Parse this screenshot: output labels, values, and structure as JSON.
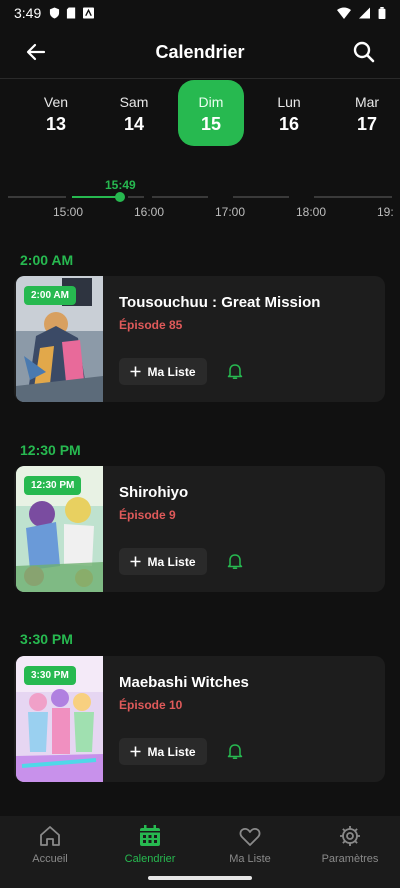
{
  "status_bar": {
    "time": "3:49"
  },
  "header": {
    "title": "Calendrier"
  },
  "days": [
    {
      "name": "Ven",
      "num": "13"
    },
    {
      "name": "Sam",
      "num": "14"
    },
    {
      "name": "Dim",
      "num": "15",
      "active": true
    },
    {
      "name": "Lun",
      "num": "16"
    },
    {
      "name": "Mar",
      "num": "17"
    }
  ],
  "timeline": {
    "now": "15:49",
    "labels": [
      "15:00",
      "16:00",
      "17:00",
      "18:00",
      "19:"
    ]
  },
  "sections": [
    {
      "time": "2:00 AM",
      "badge": "2:00 AM",
      "title": "Tousouchuu : Great Mission",
      "episode": "Épisode 85",
      "button": "Ma Liste"
    },
    {
      "time": "12:30 PM",
      "badge": "12:30 PM",
      "title": "Shirohiyo",
      "episode": "Épisode 9",
      "button": "Ma Liste"
    },
    {
      "time": "3:30 PM",
      "badge": "3:30 PM",
      "title": "Maebashi Witches",
      "episode": "Épisode 10",
      "button": "Ma Liste"
    }
  ],
  "nav": {
    "items": [
      {
        "label": "Accueil",
        "icon": "home-icon"
      },
      {
        "label": "Calendrier",
        "icon": "calendar-icon",
        "active": true
      },
      {
        "label": "Ma Liste",
        "icon": "heart-icon"
      },
      {
        "label": "Paramètres",
        "icon": "settings-icon"
      }
    ]
  },
  "colors": {
    "accent": "#27b950",
    "episode": "#e05a5a",
    "background": "#111111",
    "card": "#1d1d1d"
  }
}
